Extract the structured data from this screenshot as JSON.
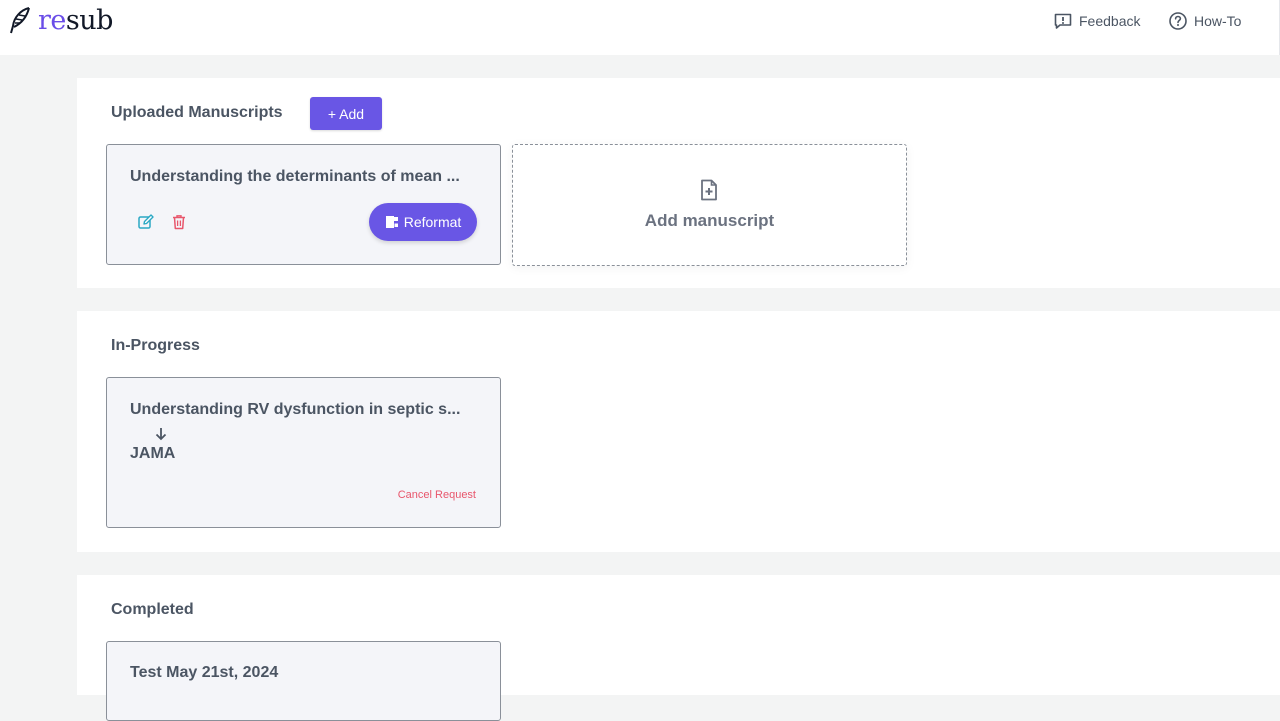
{
  "app": {
    "logo_re": "re",
    "logo_sub": "sub"
  },
  "nav": {
    "feedback": "Feedback",
    "howto": "How-To"
  },
  "uploaded": {
    "title": "Uploaded Manuscripts",
    "add_label": "+ Add",
    "card": {
      "title": "Understanding the determinants of mean ...",
      "reformat_label": "Reformat"
    },
    "add_card_label": "Add manuscript"
  },
  "in_progress": {
    "title": "In-Progress",
    "card": {
      "title": "Understanding RV dysfunction in septic s...",
      "journal": "JAMA",
      "cancel_label": "Cancel Request"
    }
  },
  "completed": {
    "title": "Completed",
    "card": {
      "title": "Test May 21st, 2024"
    }
  },
  "colors": {
    "accent": "#6956e5",
    "edit_icon": "#2aa8c4",
    "delete_icon": "#e8566c",
    "cancel_link": "#e8566c"
  }
}
